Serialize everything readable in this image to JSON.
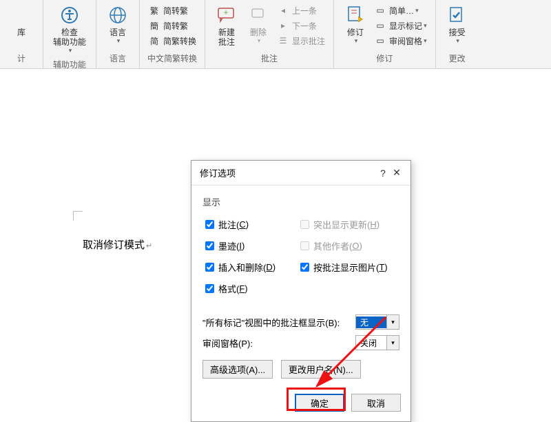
{
  "ribbon": {
    "group0": {
      "label": "计",
      "label2": "库"
    },
    "accessibility": {
      "group": "辅助功能",
      "big": "检查\n辅助功能"
    },
    "language": {
      "big": "语言",
      "group": "语言"
    },
    "chinese": {
      "group": "中文简繁转换",
      "r1": "简转繁",
      "r2": "简转繁",
      "r3": "简繁转换"
    },
    "comments": {
      "group": "批注",
      "new": "新建\n批注",
      "delete": "删除",
      "prev": "上一条",
      "next": "下一条",
      "show": "显示批注"
    },
    "track": {
      "group": "修订",
      "big": "修订",
      "simple": "简单…",
      "show": "显示标记",
      "pane": "审阅窗格"
    },
    "changes": {
      "group": "更改",
      "accept": "接受"
    }
  },
  "doc": {
    "text": "取消修订模式"
  },
  "dialog": {
    "title": "修订选项",
    "section_display": "显示",
    "cb_comments": "批注(",
    "cb_comments_u": "C",
    "cb_comments2": ")",
    "cb_hiupdate": "突出显示更新(",
    "cb_hiupdate_u": "H",
    "cb_hiupdate2": ")",
    "cb_ink": "墨迹(",
    "cb_ink_u": "I",
    "cb_ink2": ")",
    "cb_other": "其他作者(",
    "cb_other_u": "O",
    "cb_other2": ")",
    "cb_insdel": "插入和删除(",
    "cb_insdel_u": "D",
    "cb_insdel2": ")",
    "cb_pic": "按批注显示图片(",
    "cb_pic_u": "T",
    "cb_pic2": ")",
    "cb_format": "格式(",
    "cb_format_u": "F",
    "cb_format2": ")",
    "balloon_label": "\"所有标记\"视图中的批注框显示(",
    "balloon_u": "B",
    "balloon_label2": "):",
    "balloon_value": "无",
    "pane_label": "审阅窗格(",
    "pane_u": "P",
    "pane_label2": "):",
    "pane_value": "关闭",
    "btn_adv": "高级选项(",
    "btn_adv_u": "A",
    "btn_adv2": ")...",
    "btn_user": "更改用户名(",
    "btn_user_u": "N",
    "btn_user2": ")...",
    "ok": "确定",
    "cancel": "取消"
  }
}
